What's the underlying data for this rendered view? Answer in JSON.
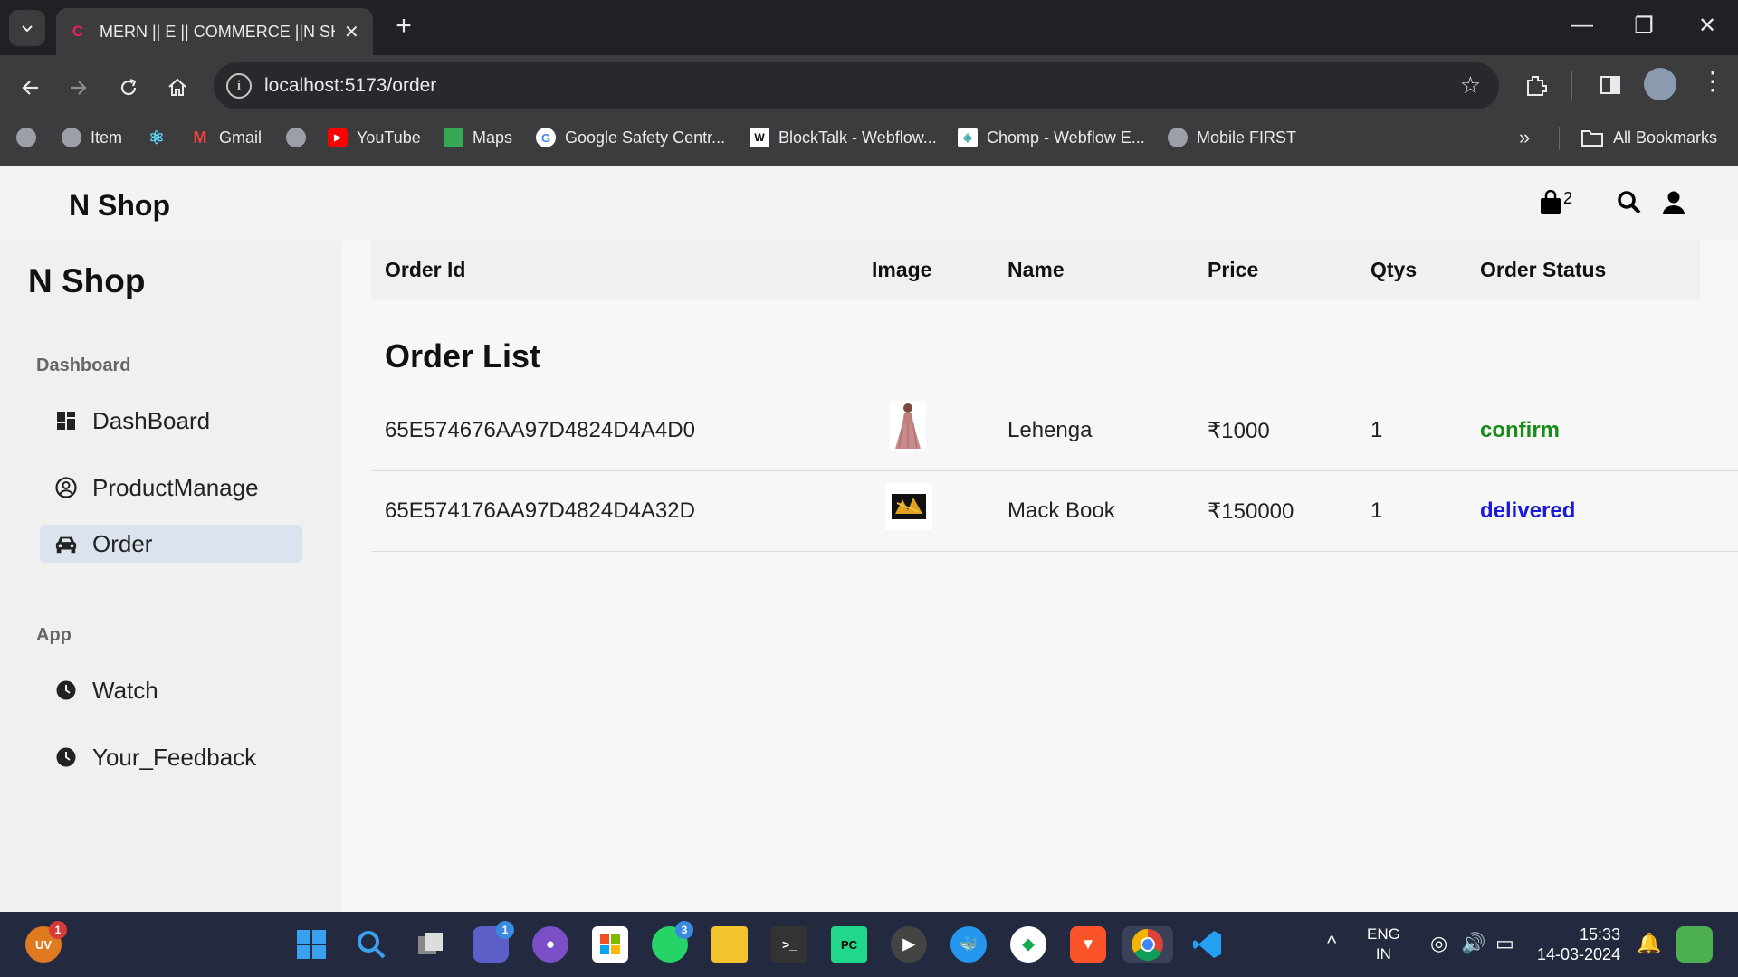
{
  "browser": {
    "tab_title": "MERN || E || COMMERCE ||N SHOP",
    "url": "localhost:5173/order",
    "bookmarks": [
      {
        "label": "",
        "icon": "globe-icon"
      },
      {
        "label": "Item",
        "icon": "globe-icon"
      },
      {
        "label": "",
        "icon": "react-icon"
      },
      {
        "label": "Gmail",
        "icon": "gmail-icon"
      },
      {
        "label": "",
        "icon": "globe-icon"
      },
      {
        "label": "YouTube",
        "icon": "youtube-icon"
      },
      {
        "label": "Maps",
        "icon": "maps-icon"
      },
      {
        "label": "Google Safety Centr...",
        "icon": "google-icon"
      },
      {
        "label": "BlockTalk - Webflow...",
        "icon": "webflow-icon"
      },
      {
        "label": "Chomp - Webflow E...",
        "icon": "chomp-icon"
      },
      {
        "label": "Mobile FIRST",
        "icon": "globe-icon"
      }
    ],
    "all_bookmarks": "All Bookmarks"
  },
  "app": {
    "brand": "N Shop",
    "cart_count": "2",
    "sidebar": {
      "brand": "N Shop",
      "section_dashboard": "Dashboard",
      "section_app": "App",
      "items": [
        {
          "label": "DashBoard",
          "icon": "grid-icon"
        },
        {
          "label": "ProductManage",
          "icon": "user-circle-icon"
        },
        {
          "label": "Order",
          "icon": "car-icon",
          "active": true
        },
        {
          "label": "Watch",
          "icon": "clock-icon"
        },
        {
          "label": "Your_Feedback",
          "icon": "clock-icon"
        }
      ]
    },
    "table": {
      "headers": [
        "Order Id",
        "Image",
        "Name",
        "Price",
        "Qtys",
        "Order Status"
      ],
      "title": "Order List",
      "rows": [
        {
          "id": "65E574676AA97D4824D4A4D0",
          "name": "Lehenga",
          "price": "₹1000",
          "qty": "1",
          "status": "confirm",
          "status_color": "#1a8a1a"
        },
        {
          "id": "65E574176AA97D4824D4A32D",
          "name": "Mack Book",
          "price": "₹150000",
          "qty": "1",
          "status": "delivered",
          "status_color": "#1a1adb"
        }
      ]
    }
  },
  "taskbar": {
    "lang_1": "ENG",
    "lang_2": "IN",
    "time": "15:33",
    "date": "14-03-2024",
    "user_badge": "1",
    "avatar_text": "UV",
    "teams_badge": "1",
    "whatsapp_badge": "3"
  }
}
